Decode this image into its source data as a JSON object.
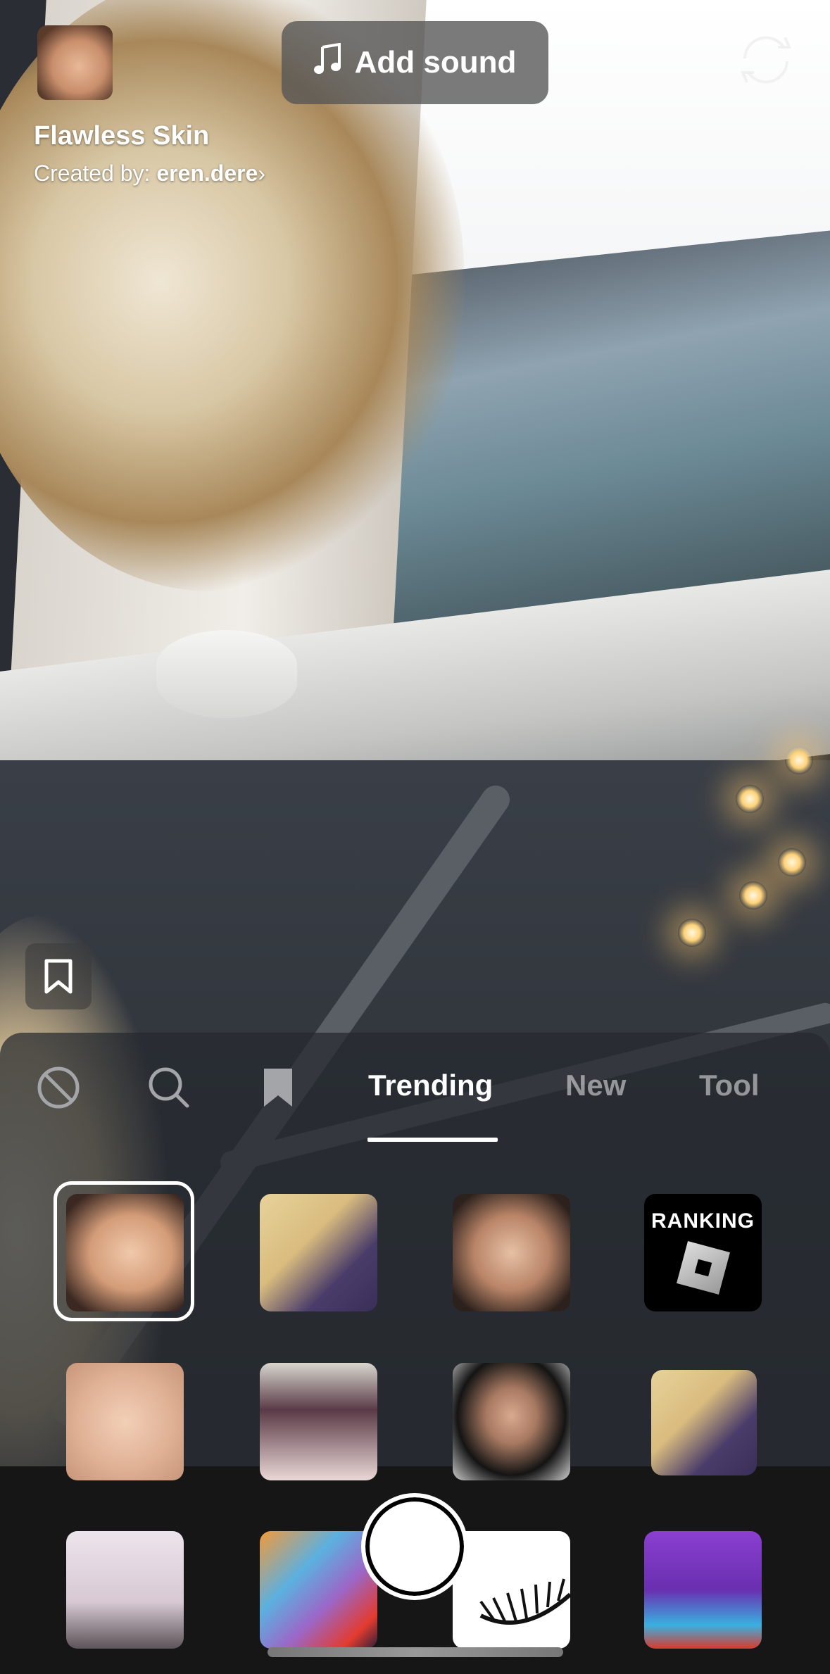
{
  "effect": {
    "title": "Flawless Skin",
    "created_by_label": "Created by:",
    "creator": "eren.dere",
    "chevron": "›"
  },
  "top": {
    "add_sound_label": "Add sound",
    "add_sound_icon": "music-note-icon",
    "flip_icon": "flip-camera-icon"
  },
  "panel": {
    "icons": [
      "no-effect-icon",
      "search-icon",
      "bookmark-icon"
    ],
    "tabs": [
      {
        "label": "Trending",
        "active": true
      },
      {
        "label": "New",
        "active": false
      },
      {
        "label": "Tool",
        "active": false
      }
    ],
    "tiles": [
      {
        "selected": true
      },
      {},
      {},
      {
        "text": "RANKING"
      },
      {},
      {},
      {},
      {},
      {},
      {},
      {},
      {}
    ]
  },
  "colors": {
    "panel_bg": "#26292f",
    "bottom_bar": "#161616",
    "active_tab": "#ffffff",
    "inactive_tab": "#9a9ca0"
  }
}
